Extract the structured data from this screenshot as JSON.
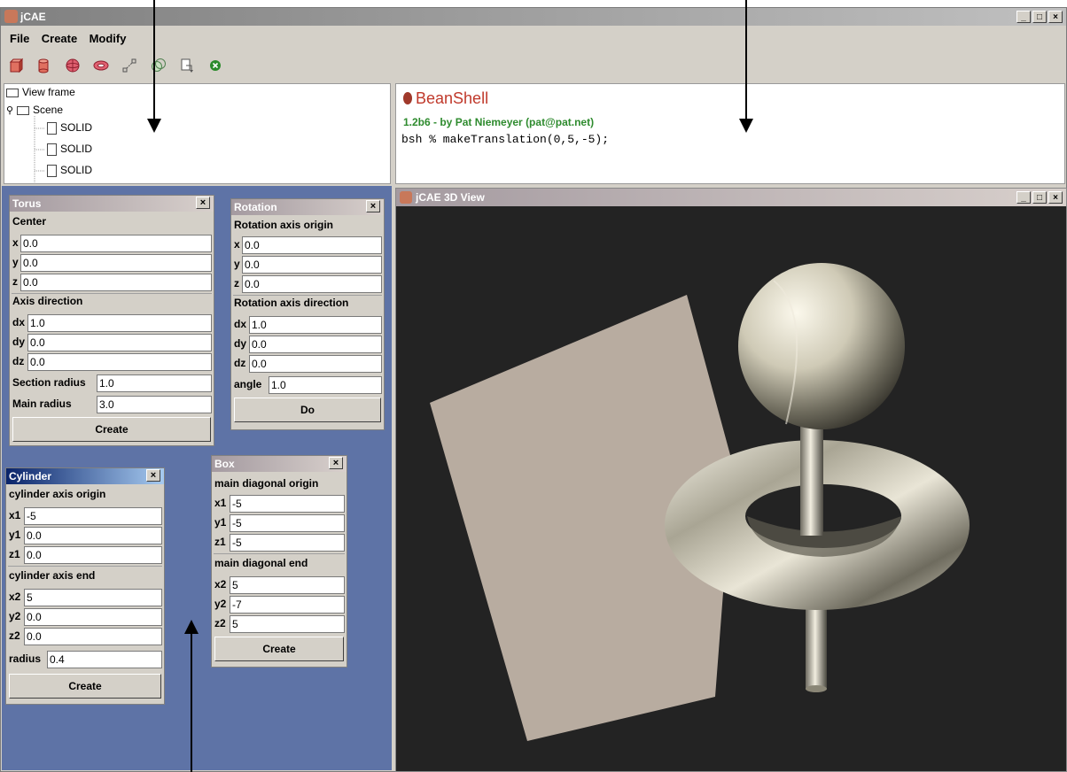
{
  "window": {
    "title": "jCAE"
  },
  "menu": {
    "items": [
      "File",
      "Create",
      "Modify"
    ]
  },
  "toolbar": {
    "tools": [
      "box-icon",
      "cylinder-icon",
      "sphere-icon",
      "torus-icon",
      "translate-icon",
      "boolean-icon",
      "rotate-icon",
      "close-circle-icon"
    ]
  },
  "tree": {
    "view_frame": "View frame",
    "scene": "Scene",
    "children": [
      "SOLID",
      "SOLID",
      "SOLID"
    ]
  },
  "console": {
    "product": "BeanShell",
    "version": "1.2b6 - by Pat Niemeyer (pat@pat.net)",
    "prompt": "bsh % makeTranslation(0,5,-5);"
  },
  "torus": {
    "title": "Torus",
    "center": "Center",
    "x_label": "x",
    "x": "0.0",
    "y_label": "y",
    "y": "0.0",
    "z_label": "z",
    "z": "0.0",
    "axis_direction": "Axis direction",
    "dx_label": "dx",
    "dx": "1.0",
    "dy_label": "dy",
    "dy": "0.0",
    "dz_label": "dz",
    "dz": "0.0",
    "section_radius_label": "Section radius",
    "section_radius": "1.0",
    "main_radius_label": "Main radius",
    "main_radius": "3.0",
    "create": "Create"
  },
  "rotation": {
    "title": "Rotation",
    "origin": "Rotation axis origin",
    "x_label": "x",
    "x": "0.0",
    "y_label": "y",
    "y": "0.0",
    "z_label": "z",
    "z": "0.0",
    "direction": "Rotation axis direction",
    "dx_label": "dx",
    "dx": "1.0",
    "dy_label": "dy",
    "dy": "0.0",
    "dz_label": "dz",
    "dz": "0.0",
    "angle_label": "angle",
    "angle": "1.0",
    "do": "Do"
  },
  "cylinder": {
    "title": "Cylinder",
    "origin": "cylinder axis origin",
    "x1_label": "x1",
    "x1": "-5",
    "y1_label": "y1",
    "y1": "0.0",
    "z1_label": "z1",
    "z1": "0.0",
    "end": "cylinder axis end",
    "x2_label": "x2",
    "x2": "5",
    "y2_label": "y2",
    "y2": "0.0",
    "z2_label": "z2",
    "z2": "0.0",
    "radius_label": "radius",
    "radius": "0.4",
    "create": "Create"
  },
  "box": {
    "title": "Box",
    "origin": "main diagonal origin",
    "x1_label": "x1",
    "x1": "-5",
    "y1_label": "y1",
    "y1": "-5",
    "z1_label": "z1",
    "z1": "-5",
    "end": "main diagonal end",
    "x2_label": "x2",
    "x2": "5",
    "y2_label": "y2",
    "y2": "-7",
    "z2_label": "z2",
    "z2": "5",
    "create": "Create"
  },
  "view3d": {
    "title": "jCAE 3D View"
  },
  "colors": {
    "desktop": "#5e73a6",
    "viewport": "#232323",
    "beanshell_green": "#2e8b2e",
    "beanshell_red": "#c0392b"
  }
}
